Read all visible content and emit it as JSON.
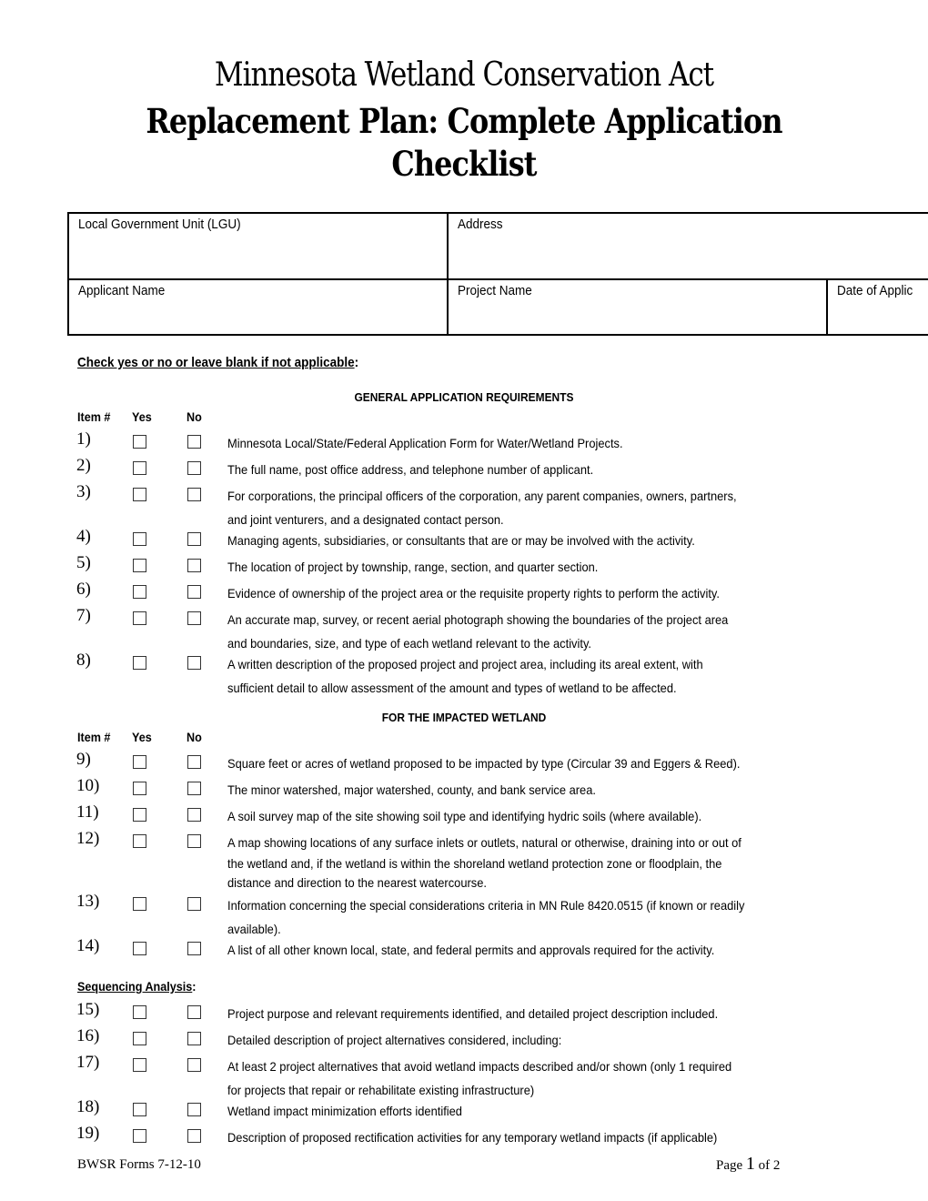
{
  "header": {
    "title": "Minnesota Wetland Conservation Act",
    "subtitle_line1": "Replacement Plan: Complete Application",
    "subtitle_line2": "Checklist"
  },
  "info_table": {
    "lgu_label": "Local Government Unit (LGU)",
    "address_label": "Address",
    "applicant_label": "Applicant Name",
    "project_label": "Project Name",
    "date_label": "Date of Applic"
  },
  "instructions": {
    "text": "Check yes or no or leave blank if not applicable",
    "suffix": ":"
  },
  "columns": {
    "item": "Item #",
    "yes": "Yes",
    "no": "No"
  },
  "sections": {
    "general": {
      "title": "GENERAL APPLICATION REQUIREMENTS",
      "items": [
        {
          "num": "1)",
          "text": "Minnesota Local/State/Federal Application Form for Water/Wetland Projects.",
          "yes": false,
          "no": false
        },
        {
          "num": "2)",
          "text": "The full name, post office address, and telephone number of applicant.",
          "yes": false,
          "no": false
        },
        {
          "num": "3)",
          "text": "For corporations, the principal officers of the corporation, any parent companies, owners, partners,\nand joint venturers, and a designated contact person.",
          "yes": false,
          "no": false
        },
        {
          "num": "4)",
          "text": "Managing agents, subsidiaries, or consultants that are or may be involved with the activity.",
          "yes": false,
          "no": false
        },
        {
          "num": "5)",
          "text": "The location of project by township, range, section, and quarter section.",
          "yes": false,
          "no": false
        },
        {
          "num": "6)",
          "text": "Evidence of ownership of the project area or the requisite property rights to perform the activity.",
          "yes": false,
          "no": false
        },
        {
          "num": "7)",
          "text": "An accurate map, survey, or recent aerial photograph showing the boundaries of the project area\nand boundaries, size, and type of each wetland relevant to the activity.",
          "yes": false,
          "no": false
        },
        {
          "num": "8)",
          "text": "A written description of the proposed project and project area, including its areal extent, with\nsufficient detail to allow assessment of the amount and types of wetland to be affected.",
          "yes": false,
          "no": false
        }
      ]
    },
    "impacted": {
      "title": "FOR THE IMPACTED WETLAND",
      "items": [
        {
          "num": "9)",
          "text": "Square feet or acres of wetland proposed to be impacted by type (Circular 39 and Eggers & Reed).",
          "yes": false,
          "no": false
        },
        {
          "num": "10)",
          "text": "The minor watershed, major watershed, county, and bank service area.",
          "yes": false,
          "no": false
        },
        {
          "num": "11)",
          "text": "A soil survey map of the site showing soil type and identifying hydric soils (where available).",
          "yes": false,
          "no": false
        },
        {
          "num": "12)",
          "text": "A map showing locations of any surface inlets or outlets, natural or otherwise, draining into or out of\nthe wetland and, if the wetland is within the shoreland wetland protection zone or floodplain, the\ndistance and direction to the nearest watercourse.",
          "yes": false,
          "no": false
        },
        {
          "num": "13)",
          "text": "Information concerning the special considerations criteria in MN Rule 8420.0515 (if known or readily\navailable).",
          "yes": false,
          "no": false
        },
        {
          "num": "14)",
          "text": "A list of all other known local, state, and federal permits and approvals required for the activity.",
          "yes": false,
          "no": false
        }
      ]
    },
    "sequencing": {
      "title": "Sequencing Analysis",
      "suffix": ":",
      "items": [
        {
          "num": "15)",
          "text": "Project purpose and relevant requirements identified, and detailed project description included.",
          "yes": false,
          "no": false
        },
        {
          "num": "16)",
          "text": "Detailed description of project alternatives considered, including:",
          "yes": false,
          "no": false
        },
        {
          "num": "17)",
          "text": "At least 2 project alternatives that avoid wetland impacts described and/or shown (only 1 required\nfor projects that repair or rehabilitate existing infrastructure)",
          "yes": false,
          "no": false
        },
        {
          "num": "18)",
          "text": "Wetland impact minimization efforts identified",
          "yes": false,
          "no": false
        },
        {
          "num": "19)",
          "text": "Description of proposed rectification activities for any temporary wetland impacts (if applicable)",
          "yes": false,
          "no": false
        }
      ]
    }
  },
  "footer": {
    "form_id": "BWSR Forms 7-12-10",
    "page_prefix": "Page ",
    "page_current": "1",
    "page_suffix": " of 2"
  }
}
